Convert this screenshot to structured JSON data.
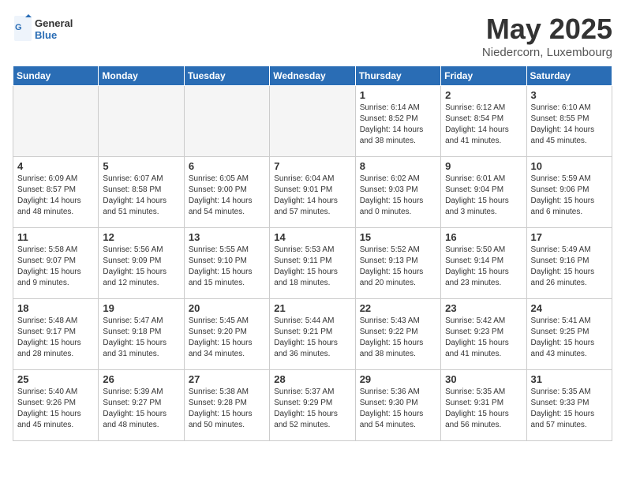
{
  "logo": {
    "general": "General",
    "blue": "Blue"
  },
  "title": "May 2025",
  "subtitle": "Niedercorn, Luxembourg",
  "days_of_week": [
    "Sunday",
    "Monday",
    "Tuesday",
    "Wednesday",
    "Thursday",
    "Friday",
    "Saturday"
  ],
  "weeks": [
    [
      {
        "day": "",
        "info": "",
        "empty": true
      },
      {
        "day": "",
        "info": "",
        "empty": true
      },
      {
        "day": "",
        "info": "",
        "empty": true
      },
      {
        "day": "",
        "info": "",
        "empty": true
      },
      {
        "day": "1",
        "info": "Sunrise: 6:14 AM\nSunset: 8:52 PM\nDaylight: 14 hours\nand 38 minutes."
      },
      {
        "day": "2",
        "info": "Sunrise: 6:12 AM\nSunset: 8:54 PM\nDaylight: 14 hours\nand 41 minutes."
      },
      {
        "day": "3",
        "info": "Sunrise: 6:10 AM\nSunset: 8:55 PM\nDaylight: 14 hours\nand 45 minutes."
      }
    ],
    [
      {
        "day": "4",
        "info": "Sunrise: 6:09 AM\nSunset: 8:57 PM\nDaylight: 14 hours\nand 48 minutes."
      },
      {
        "day": "5",
        "info": "Sunrise: 6:07 AM\nSunset: 8:58 PM\nDaylight: 14 hours\nand 51 minutes."
      },
      {
        "day": "6",
        "info": "Sunrise: 6:05 AM\nSunset: 9:00 PM\nDaylight: 14 hours\nand 54 minutes."
      },
      {
        "day": "7",
        "info": "Sunrise: 6:04 AM\nSunset: 9:01 PM\nDaylight: 14 hours\nand 57 minutes."
      },
      {
        "day": "8",
        "info": "Sunrise: 6:02 AM\nSunset: 9:03 PM\nDaylight: 15 hours\nand 0 minutes."
      },
      {
        "day": "9",
        "info": "Sunrise: 6:01 AM\nSunset: 9:04 PM\nDaylight: 15 hours\nand 3 minutes."
      },
      {
        "day": "10",
        "info": "Sunrise: 5:59 AM\nSunset: 9:06 PM\nDaylight: 15 hours\nand 6 minutes."
      }
    ],
    [
      {
        "day": "11",
        "info": "Sunrise: 5:58 AM\nSunset: 9:07 PM\nDaylight: 15 hours\nand 9 minutes."
      },
      {
        "day": "12",
        "info": "Sunrise: 5:56 AM\nSunset: 9:09 PM\nDaylight: 15 hours\nand 12 minutes."
      },
      {
        "day": "13",
        "info": "Sunrise: 5:55 AM\nSunset: 9:10 PM\nDaylight: 15 hours\nand 15 minutes."
      },
      {
        "day": "14",
        "info": "Sunrise: 5:53 AM\nSunset: 9:11 PM\nDaylight: 15 hours\nand 18 minutes."
      },
      {
        "day": "15",
        "info": "Sunrise: 5:52 AM\nSunset: 9:13 PM\nDaylight: 15 hours\nand 20 minutes."
      },
      {
        "day": "16",
        "info": "Sunrise: 5:50 AM\nSunset: 9:14 PM\nDaylight: 15 hours\nand 23 minutes."
      },
      {
        "day": "17",
        "info": "Sunrise: 5:49 AM\nSunset: 9:16 PM\nDaylight: 15 hours\nand 26 minutes."
      }
    ],
    [
      {
        "day": "18",
        "info": "Sunrise: 5:48 AM\nSunset: 9:17 PM\nDaylight: 15 hours\nand 28 minutes."
      },
      {
        "day": "19",
        "info": "Sunrise: 5:47 AM\nSunset: 9:18 PM\nDaylight: 15 hours\nand 31 minutes."
      },
      {
        "day": "20",
        "info": "Sunrise: 5:45 AM\nSunset: 9:20 PM\nDaylight: 15 hours\nand 34 minutes."
      },
      {
        "day": "21",
        "info": "Sunrise: 5:44 AM\nSunset: 9:21 PM\nDaylight: 15 hours\nand 36 minutes."
      },
      {
        "day": "22",
        "info": "Sunrise: 5:43 AM\nSunset: 9:22 PM\nDaylight: 15 hours\nand 38 minutes."
      },
      {
        "day": "23",
        "info": "Sunrise: 5:42 AM\nSunset: 9:23 PM\nDaylight: 15 hours\nand 41 minutes."
      },
      {
        "day": "24",
        "info": "Sunrise: 5:41 AM\nSunset: 9:25 PM\nDaylight: 15 hours\nand 43 minutes."
      }
    ],
    [
      {
        "day": "25",
        "info": "Sunrise: 5:40 AM\nSunset: 9:26 PM\nDaylight: 15 hours\nand 45 minutes."
      },
      {
        "day": "26",
        "info": "Sunrise: 5:39 AM\nSunset: 9:27 PM\nDaylight: 15 hours\nand 48 minutes."
      },
      {
        "day": "27",
        "info": "Sunrise: 5:38 AM\nSunset: 9:28 PM\nDaylight: 15 hours\nand 50 minutes."
      },
      {
        "day": "28",
        "info": "Sunrise: 5:37 AM\nSunset: 9:29 PM\nDaylight: 15 hours\nand 52 minutes."
      },
      {
        "day": "29",
        "info": "Sunrise: 5:36 AM\nSunset: 9:30 PM\nDaylight: 15 hours\nand 54 minutes."
      },
      {
        "day": "30",
        "info": "Sunrise: 5:35 AM\nSunset: 9:31 PM\nDaylight: 15 hours\nand 56 minutes."
      },
      {
        "day": "31",
        "info": "Sunrise: 5:35 AM\nSunset: 9:33 PM\nDaylight: 15 hours\nand 57 minutes."
      }
    ]
  ]
}
